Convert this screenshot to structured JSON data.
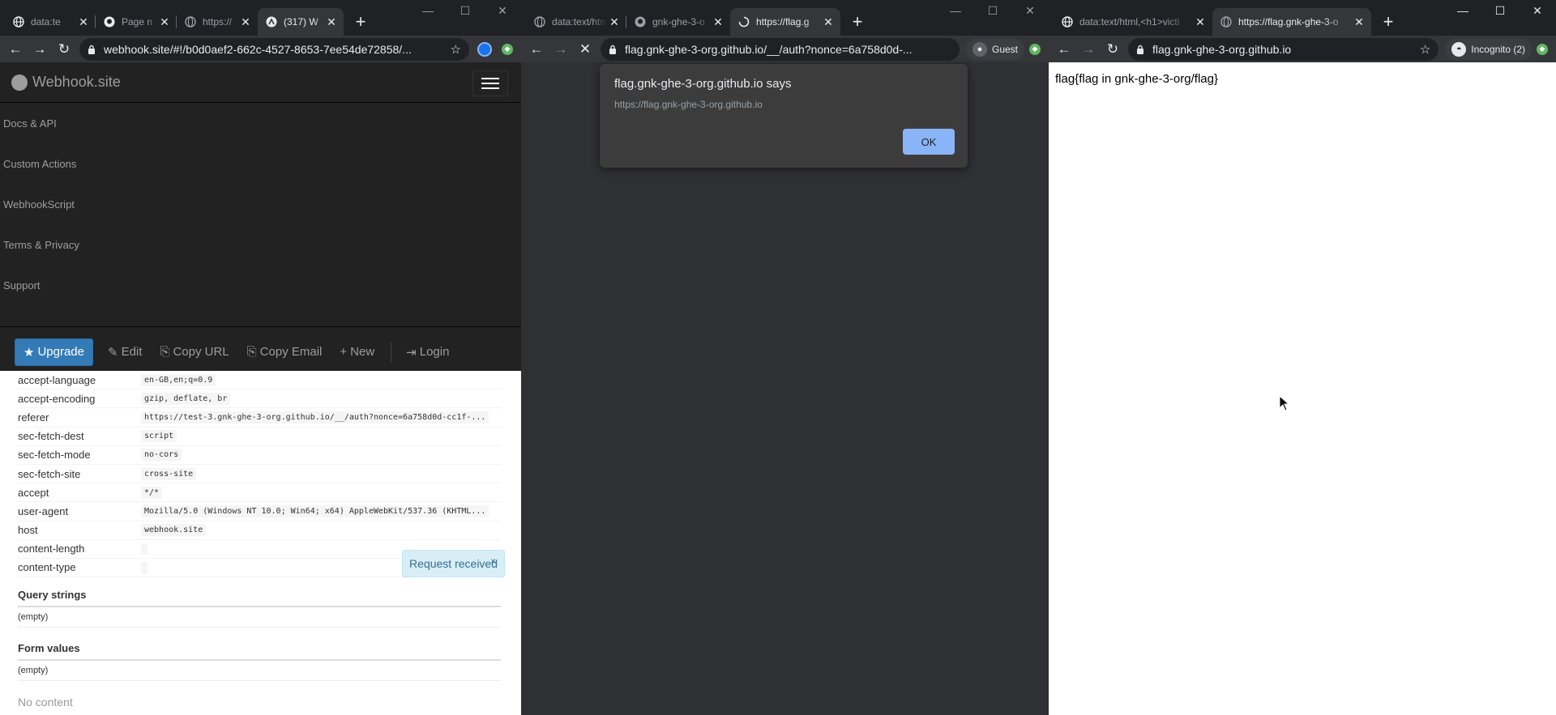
{
  "window1": {
    "tabs": [
      {
        "title": "data:te",
        "icon": "globe-icon"
      },
      {
        "title": "Page n",
        "icon": "github-icon"
      },
      {
        "title": "https://",
        "icon": "globe-icon"
      },
      {
        "title": "(317) W",
        "icon": "webhook-icon",
        "active": true
      }
    ],
    "url": "webhook.site/#!/b0d0aef2-662c-4527-8653-7ee54de72858/...",
    "brand": "Webhook.site",
    "menu": [
      "Docs & API",
      "Custom Actions",
      "WebhookScript",
      "Terms & Privacy",
      "Support"
    ],
    "buttons": {
      "upgrade": "Upgrade",
      "edit": "Edit",
      "copy_url": "Copy URL",
      "copy_email": "Copy Email",
      "new": "New",
      "login": "Login"
    },
    "headers": [
      {
        "key": "accept-language",
        "value": "en-GB,en;q=0.9"
      },
      {
        "key": "accept-encoding",
        "value": "gzip, deflate, br"
      },
      {
        "key": "referer",
        "value": "https://test-3.gnk-ghe-3-org.github.io/__/auth?nonce=6a758d0d-cc1f-..."
      },
      {
        "key": "sec-fetch-dest",
        "value": "script"
      },
      {
        "key": "sec-fetch-mode",
        "value": "no-cors"
      },
      {
        "key": "sec-fetch-site",
        "value": "cross-site"
      },
      {
        "key": "accept",
        "value": "*/*"
      },
      {
        "key": "user-agent",
        "value": "Mozilla/5.0 (Windows NT 10.0; Win64; x64) AppleWebKit/537.36 (KHTML..."
      },
      {
        "key": "host",
        "value": "webhook.site"
      },
      {
        "key": "content-length",
        "value": ""
      },
      {
        "key": "content-type",
        "value": ""
      }
    ],
    "query_strings_title": "Query strings",
    "query_strings_value": "(empty)",
    "form_values_title": "Form values",
    "form_values_value": "(empty)",
    "no_content": "No content",
    "toast": "Request received"
  },
  "window2": {
    "tabs": [
      {
        "title": "data:text/htm",
        "icon": "globe-icon"
      },
      {
        "title": "gnk-ghe-3-o",
        "icon": "github-icon"
      },
      {
        "title": "https://flag.g",
        "icon": "loading-icon",
        "active": true
      }
    ],
    "url": "flag.gnk-ghe-3-org.github.io/__/auth?nonce=6a758d0d-...",
    "profile": "Guest",
    "alert": {
      "title": "flag.gnk-ghe-3-org.github.io says",
      "message": "https://flag.gnk-ghe-3-org.github.io",
      "ok": "OK"
    }
  },
  "window3": {
    "tabs": [
      {
        "title": "data:text/html,<h1>victi",
        "icon": "globe-icon"
      },
      {
        "title": "https://flag.gnk-ghe-3-o",
        "icon": "globe-icon",
        "active": true
      }
    ],
    "url": "flag.gnk-ghe-3-org.github.io",
    "profile": "Incognito (2)",
    "content": "flag{flag in gnk-ghe-3-org/flag}"
  },
  "colors": {
    "chrome_dark": "#202124",
    "chrome_toolbar": "#35363a",
    "webhook_nav": "#222222",
    "upgrade_blue": "#337ab7",
    "alert_ok": "#8ab4f8"
  }
}
